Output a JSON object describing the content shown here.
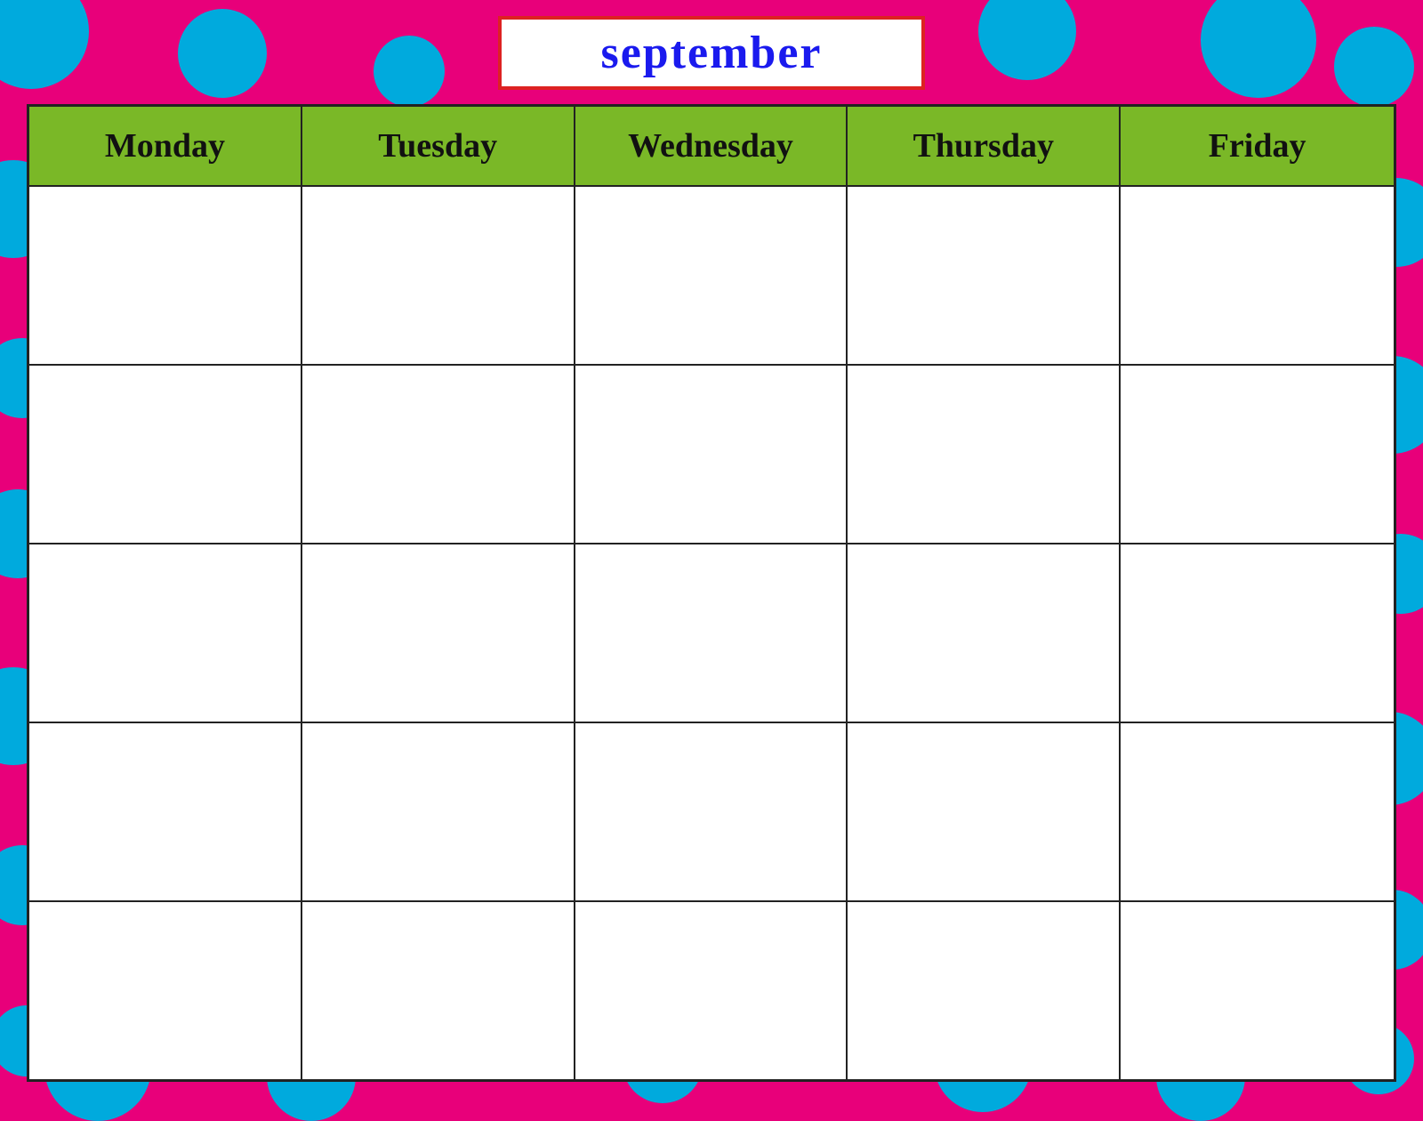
{
  "background": {
    "color": "#e8007a",
    "dot_color": "#00aadd"
  },
  "title": {
    "text": "september",
    "border_color": "#dd2222",
    "text_color": "#1a1aee"
  },
  "calendar": {
    "header_bg": "#7ab827",
    "days": [
      {
        "label": "Monday"
      },
      {
        "label": "Tuesday"
      },
      {
        "label": "Wednesday"
      },
      {
        "label": "Thursday"
      },
      {
        "label": "Friday"
      }
    ],
    "rows": 5
  }
}
